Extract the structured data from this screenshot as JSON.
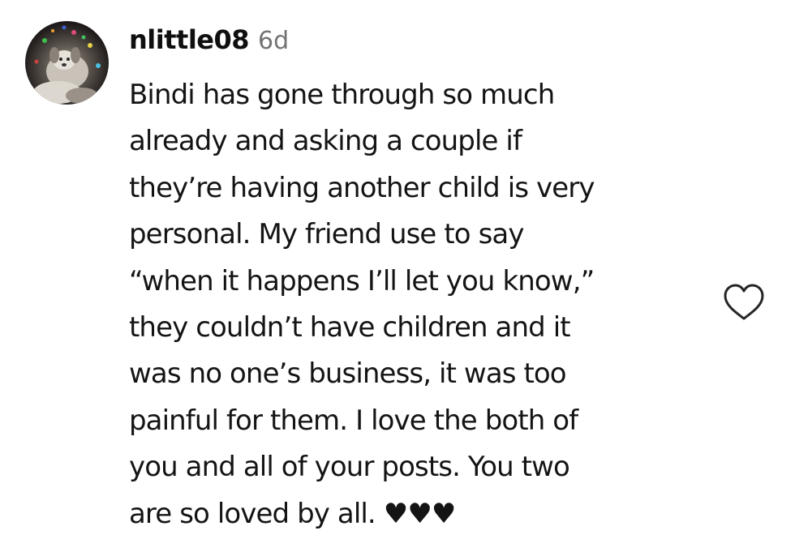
{
  "comment": {
    "username": "nlittle08",
    "timestamp": "6d",
    "avatar_icon": "profile-photo",
    "like_icon": "heart-outline-icon",
    "lines": [
      "Bindi has gone through so much",
      "already and asking a couple if",
      "they’re having another child is very",
      "personal. My friend use to say",
      "“when it happens I’ll let you know,”",
      "they couldn’t have children and it",
      "was no one’s business, it was too",
      "painful for them. I love the both of",
      "you and all of your posts. You two",
      "are so loved by all. ♥♥♥"
    ]
  }
}
